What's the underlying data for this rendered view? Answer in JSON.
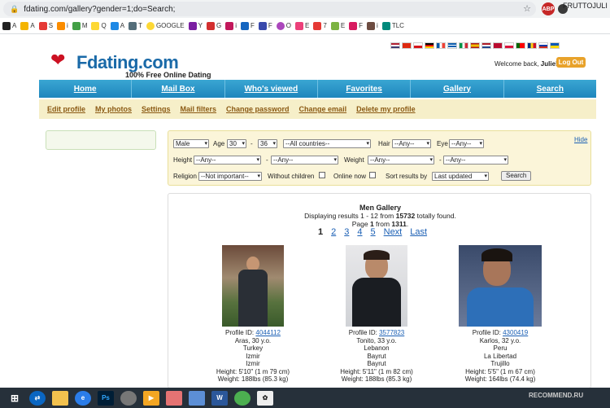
{
  "browser": {
    "url": "fdating.com/gallery?gender=1;do=Search;",
    "profile_name": "FRUTTOJULI",
    "bookmarks": [
      "A",
      "A",
      "S",
      "i",
      "M",
      "Q",
      "A",
      "T",
      "GOOGLE",
      "Y",
      "G",
      "i",
      "F",
      "F",
      "O",
      "E",
      "7",
      "E",
      "F",
      "i",
      "TLC"
    ]
  },
  "site": {
    "logo_text": "Fdating.com",
    "logo_sub": "100% Free Online Dating",
    "welcome_prefix": "Welcome back,",
    "welcome_user": "Julie",
    "welcome_suffix": "!",
    "logout": "Log Out"
  },
  "nav": [
    "Home",
    "Mail Box",
    "Who's viewed",
    "Favorites",
    "Gallery",
    "Search"
  ],
  "subnav": [
    "Edit profile",
    "My photos",
    "Settings",
    "Mail filters",
    "Change password",
    "Change email",
    "Delete my profile"
  ],
  "filters": {
    "gender": "Male",
    "age_label": "Age",
    "age_from": "30",
    "age_dash": "-",
    "age_to": "36",
    "country": "--All countries--",
    "hair_label": "Hair",
    "hair": "--Any--",
    "eye_label": "Eye",
    "eye": "--Any--",
    "hide": "Hide",
    "height_label": "Height",
    "height_from": "--Any--",
    "height_dash": "-",
    "height_to": "--Any--",
    "weight_label": "Weight",
    "weight_from": "--Any--",
    "weight_dash": "-",
    "weight_to": "--Any--",
    "religion_label": "Religion",
    "religion": "--Not important--",
    "without_children": "Without children",
    "online_now": "Online now",
    "sort_label": "Sort results by",
    "sort": "Last updated",
    "search": "Search"
  },
  "gallery": {
    "title": "Men Gallery",
    "displaying": "Displaying results 1 - 12 from ",
    "total": "15732",
    "found_suffix": " totally found.",
    "page_prefix": "Page ",
    "page_current": "1",
    "page_mid": " from ",
    "page_total": "1311",
    "page_end": ".",
    "pages": [
      "1",
      "2",
      "3",
      "4",
      "5",
      "Next",
      "Last"
    ],
    "profiles": [
      {
        "id_label": "Profile ID:",
        "id": "4044112",
        "name_age": "Aras, 30 y.o.",
        "country": "Turkey",
        "region": "Izmir",
        "city": "Izmir",
        "height": "Height: 5'10\" (1 m 79 cm)",
        "weight": "Weight: 188lbs (85.3 kg)"
      },
      {
        "id_label": "Profile ID:",
        "id": "3577823",
        "name_age": "Tonito, 33 y.o.",
        "country": "Lebanon",
        "region": "Bayrut",
        "city": "Bayrut",
        "height": "Height: 5'11\" (1 m 82 cm)",
        "weight": "Weight: 188lbs (85.3 kg)"
      },
      {
        "id_label": "Profile ID:",
        "id": "4300419",
        "name_age": "Karlos, 32 y.o.",
        "country": "Peru",
        "region": "La Libertad",
        "city": "Trujillo",
        "height": "Height: 5'5\" (1 m 67 cm)",
        "weight": "Weight: 164lbs (74.4 kg)"
      }
    ]
  },
  "watermark": "RECOMMEND.RU",
  "colors": {
    "nav": "#1e86bd",
    "subnav_bg": "#f6efc9",
    "logo": "#1a6aa8",
    "logout": "#e8a22a"
  }
}
